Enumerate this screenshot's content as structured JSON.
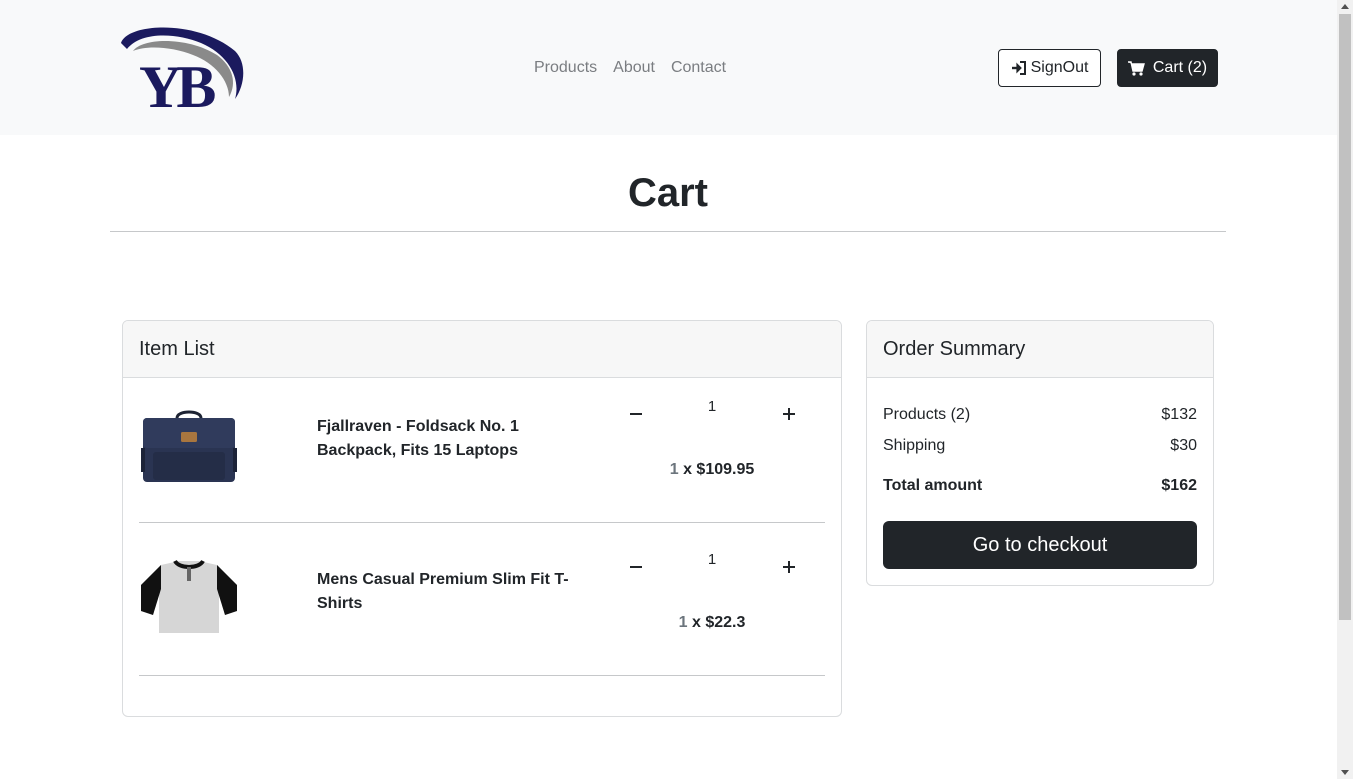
{
  "brand": {
    "logo_text": "YB"
  },
  "nav": {
    "links": [
      "Products",
      "About",
      "Contact"
    ],
    "signout_label": "SignOut",
    "cart_label": "Cart (2)"
  },
  "page": {
    "title": "Cart"
  },
  "item_list": {
    "title": "Item List",
    "items": [
      {
        "name": "Fjallraven - Foldsack No. 1 Backpack, Fits 15 Laptops",
        "quantity": "1",
        "line_qty": "1",
        "line_price": " x $109.95",
        "image": "backpack"
      },
      {
        "name": "Mens Casual Premium Slim Fit T-Shirts",
        "quantity": "1",
        "line_qty": "1",
        "line_price": " x $22.3",
        "image": "tshirt"
      }
    ]
  },
  "summary": {
    "title": "Order Summary",
    "products_label": "Products (2)",
    "products_value": "$132",
    "shipping_label": "Shipping",
    "shipping_value": "$30",
    "total_label": "Total amount",
    "total_value": "$162",
    "checkout_label": "Go to checkout"
  },
  "colors": {
    "navbar_bg": "#f8f9fa",
    "dark": "#212529",
    "muted": "#6c757d",
    "logo_navy": "#1b1a5e"
  },
  "icons": {
    "signout": "sign-in-icon",
    "cart": "shopping-cart-icon",
    "minus": "minus-icon",
    "plus": "plus-icon"
  }
}
